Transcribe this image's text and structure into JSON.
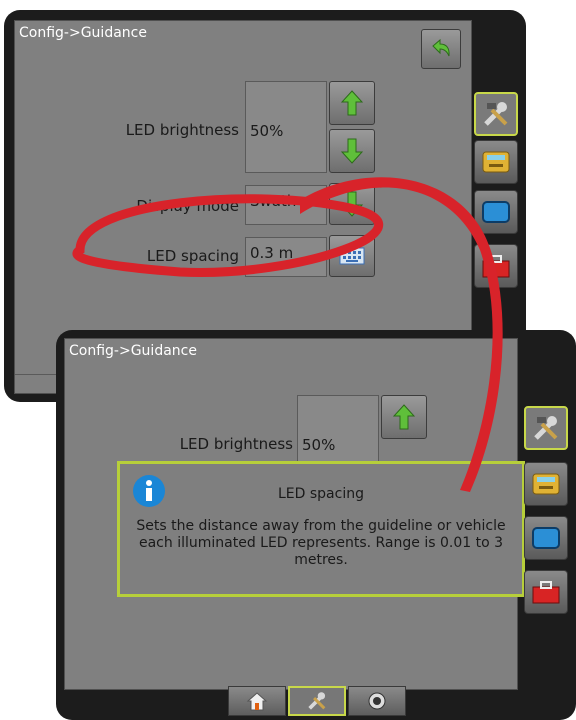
{
  "back_screen": {
    "title": "Config->Guidance",
    "led_brightness_label": "LED brightness",
    "led_brightness_value": "50%",
    "display_mode_label": "Display mode",
    "display_mode_value": "Swath",
    "led_spacing_label": "LED spacing",
    "led_spacing_value": "0.3 m"
  },
  "front_screen": {
    "title": "Config->Guidance",
    "led_brightness_label": "LED brightness",
    "led_brightness_value": "50%",
    "dialog": {
      "title": "LED spacing",
      "body": "Sets the distance away from the guideline or vehicle each illuminated LED represents. Range is 0.01 to 3 metres."
    }
  },
  "icons": {
    "back": "back-arrow-icon",
    "up": "up-arrow-icon",
    "down": "down-arrow-icon",
    "keyboard": "keyboard-icon",
    "tools": "tools-icon",
    "console": "console-icon",
    "display": "display-icon",
    "toolbox": "toolbox-icon",
    "info": "info-icon",
    "home": "home-icon",
    "settings": "settings-icon",
    "camera": "camera-icon"
  },
  "colors": {
    "panel": "#808080",
    "bezel": "#1c1c1c",
    "accent": "#c8d84a",
    "arrow_green": "#5fbf3a",
    "callout_red": "#d8232a",
    "info_blue": "#1a86d6"
  }
}
